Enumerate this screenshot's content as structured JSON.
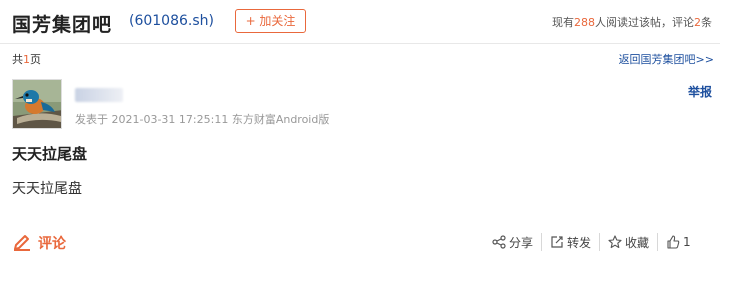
{
  "header": {
    "bar_title": "国芳集团吧",
    "stock_code": "(601086.sh)",
    "follow_label": "+ 加关注",
    "stats_prefix": "现有",
    "readers": "288",
    "stats_middle": "人阅读过该帖，评论",
    "comments": "2",
    "stats_suffix": "条"
  },
  "pager": {
    "prefix": "共",
    "pages": "1",
    "suffix": "页"
  },
  "back_link": "返回国芳集团吧>>",
  "post": {
    "report_label": "举报",
    "meta": "发表于 2021-03-31 17:25:11 东方财富Android版",
    "title": "天天拉尾盘",
    "body": "天天拉尾盘"
  },
  "footer": {
    "comment_label": "评论",
    "share_label": "分享",
    "repost_label": "转发",
    "favorite_label": "收藏",
    "like_count": "1"
  },
  "colors": {
    "accent": "#e9683c",
    "link": "#1d4f9e"
  }
}
